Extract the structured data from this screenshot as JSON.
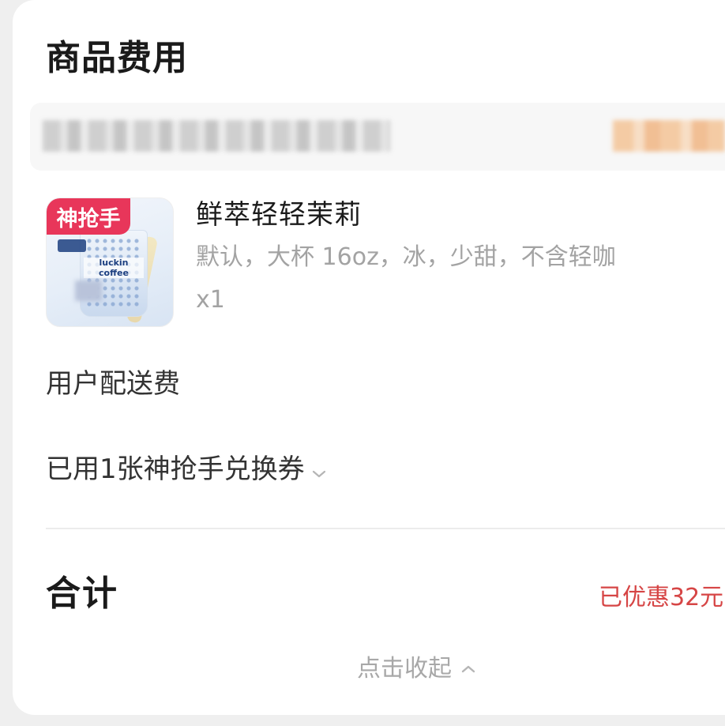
{
  "section": {
    "title": "商品费用"
  },
  "item": {
    "badge": "神抢手",
    "cup_text": "luckin coffee",
    "name": "鲜萃轻轻茉莉",
    "spec": "默认，大杯 16oz，冰，少甜，不含轻咖",
    "quantity": "x1"
  },
  "delivery": {
    "label": "用户配送费"
  },
  "coupon": {
    "label": "已用1张神抢手兑换券",
    "icon": "chevron-down-icon"
  },
  "total": {
    "label": "合计",
    "discount": "已优惠32元"
  },
  "collapse": {
    "label": "点击收起",
    "icon": "chevron-up-icon"
  },
  "colors": {
    "discount": "#d64545",
    "badge": "#e8365a",
    "muted_text": "#a3a3a3"
  }
}
